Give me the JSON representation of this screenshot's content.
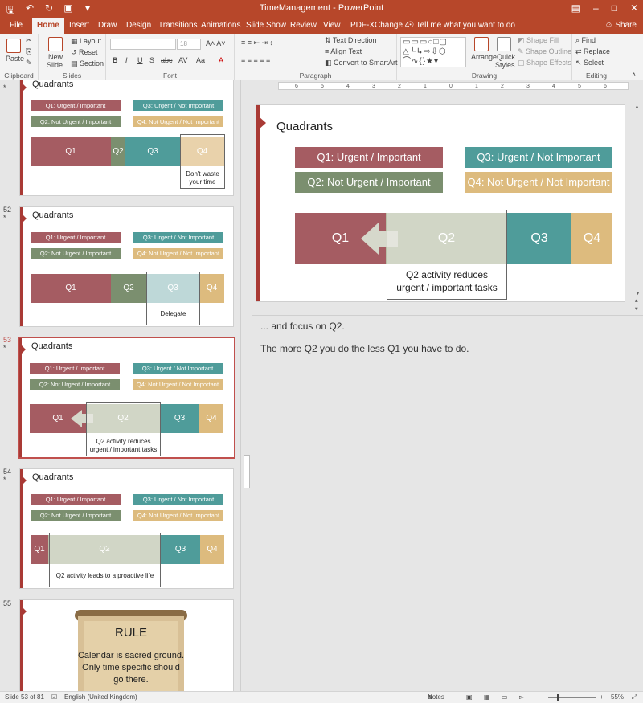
{
  "window": {
    "title": "TimeManagement - PowerPoint",
    "qat_icons": [
      "save-icon",
      "undo-icon",
      "redo-icon",
      "present-icon",
      "customize-icon"
    ]
  },
  "tabs": [
    "File",
    "Home",
    "Insert",
    "Draw",
    "Design",
    "Transitions",
    "Animations",
    "Slide Show",
    "Review",
    "View",
    "PDF-XChange 4"
  ],
  "active_tab": "Home",
  "tell_me": "Tell me what you want to do",
  "share": "Share",
  "ribbon": {
    "clipboard": {
      "label": "Clipboard",
      "paste": "Paste"
    },
    "slides": {
      "label": "Slides",
      "new_slide_1": "New",
      "new_slide_2": "Slide",
      "layout": "Layout",
      "reset": "Reset",
      "section": "Section"
    },
    "font": {
      "label": "Font",
      "size": "18"
    },
    "paragraph": {
      "label": "Paragraph",
      "text_direction": "Text Direction",
      "align_text": "Align Text",
      "convert": "Convert to SmartArt"
    },
    "drawing": {
      "label": "Drawing",
      "arrange": "Arrange",
      "quick_styles_1": "Quick",
      "quick_styles_2": "Styles",
      "shape_fill": "Shape Fill",
      "shape_outline": "Shape Outline",
      "shape_effects": "Shape Effects"
    },
    "editing": {
      "label": "Editing",
      "find": "Find",
      "replace": "Replace",
      "select": "Select"
    },
    "font_buttons": [
      "B",
      "I",
      "U",
      "S",
      "abc",
      "AV",
      "Aa",
      "A"
    ]
  },
  "thumb_common": {
    "title": "Quadrants",
    "q1": "Q1: Urgent / Important",
    "q2": "Q2: Not Urgent / Important",
    "q3": "Q3: Urgent / Not Important",
    "q4": "Q4: Not Urgent / Not Important",
    "b1": "Q1",
    "b2": "Q2",
    "b3": "Q3",
    "b4": "Q4"
  },
  "thumbs": [
    {
      "num": "",
      "star": "*",
      "callout": "Don't waste your time"
    },
    {
      "num": "52",
      "star": "*",
      "callout": "Delegate"
    },
    {
      "num": "53",
      "star": "*",
      "callout": "Q2 activity reduces urgent / important tasks"
    },
    {
      "num": "54",
      "star": "*",
      "callout": "Q2 activity leads to a proactive life"
    },
    {
      "num": "55",
      "star": "",
      "rule_title": "RULE",
      "rule_text_1": "Calendar is sacred ground.",
      "rule_text_2": "Only time specific should",
      "rule_text_3": "go there."
    }
  ],
  "slide": {
    "title": "Quadrants",
    "q1": "Q1: Urgent / Important",
    "q2": "Q2: Not Urgent / Important",
    "q3": "Q3: Urgent / Not Important",
    "q4": "Q4: Not Urgent / Not Important",
    "b1": "Q1",
    "b2": "Q2",
    "b3": "Q3",
    "b4": "Q4",
    "callout_1": "Q2 activity reduces",
    "callout_2": "urgent / important tasks"
  },
  "ruler_ticks": [
    "6",
    "5",
    "4",
    "3",
    "2",
    "1",
    "0",
    "1",
    "2",
    "3",
    "4",
    "5",
    "6"
  ],
  "notes": {
    "line1": "... and focus on Q2.",
    "line2": "The more Q2 you do the less Q1 you have to do."
  },
  "status": {
    "slide": "Slide 53 of 81",
    "language": "English (United Kingdom)",
    "notes": "Notes",
    "zoom": "55%"
  },
  "colors": {
    "accent": "#b7472a",
    "q1": "#a55c62",
    "q2": "#7b8f6f",
    "q3": "#4f9c9a",
    "q4": "#ddbb7e"
  }
}
